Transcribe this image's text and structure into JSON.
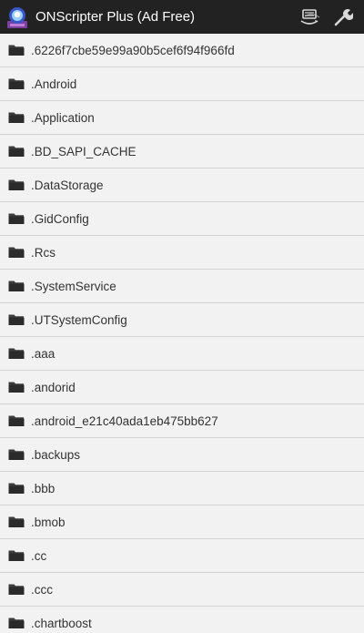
{
  "action_bar": {
    "title": "ONScripter Plus (Ad Free)",
    "app_icon": "onscripter-app-icon",
    "actions": [
      {
        "name": "storage-switch-icon"
      },
      {
        "name": "settings-wrench-icon"
      }
    ]
  },
  "colors": {
    "action_bar_bg": "#222222",
    "list_bg": "#f2f2f2",
    "divider": "#d4d4d4",
    "text": "#333333"
  },
  "file_list": {
    "items": [
      {
        "label": ".6226f7cbe59e99a90b5cef6f94f966fd",
        "icon": "folder-icon"
      },
      {
        "label": ".Android",
        "icon": "folder-icon"
      },
      {
        "label": ".Application",
        "icon": "folder-icon"
      },
      {
        "label": ".BD_SAPI_CACHE",
        "icon": "folder-icon"
      },
      {
        "label": ".DataStorage",
        "icon": "folder-icon"
      },
      {
        "label": ".GidConfig",
        "icon": "folder-icon"
      },
      {
        "label": ".Rcs",
        "icon": "folder-icon"
      },
      {
        "label": ".SystemService",
        "icon": "folder-icon"
      },
      {
        "label": ".UTSystemConfig",
        "icon": "folder-icon"
      },
      {
        "label": ".aaa",
        "icon": "folder-icon"
      },
      {
        "label": ".andorid",
        "icon": "folder-icon"
      },
      {
        "label": ".android_e21c40ada1eb475bb627",
        "icon": "folder-icon"
      },
      {
        "label": ".backups",
        "icon": "folder-icon"
      },
      {
        "label": ".bbb",
        "icon": "folder-icon"
      },
      {
        "label": ".bmob",
        "icon": "folder-icon"
      },
      {
        "label": ".cc",
        "icon": "folder-icon"
      },
      {
        "label": ".ccc",
        "icon": "folder-icon"
      },
      {
        "label": ".chartboost",
        "icon": "folder-icon"
      }
    ]
  }
}
